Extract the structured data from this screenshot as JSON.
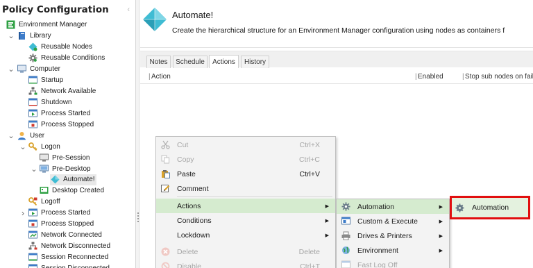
{
  "nav": {
    "title": "Policy Configuration",
    "collapse_glyph": "‹",
    "tree": [
      {
        "label": "Environment Manager",
        "icon": "environment-manager-icon",
        "twist": "",
        "selected": false
      },
      {
        "label": "Library",
        "icon": "library-book-icon",
        "twist": "v",
        "selected": false
      },
      {
        "label": "Reusable Nodes",
        "icon": "reusable-nodes-icon",
        "twist": "",
        "selected": false
      },
      {
        "label": "Reusable Conditions",
        "icon": "reusable-conditions-gear-icon",
        "twist": "",
        "selected": false
      },
      {
        "label": "Computer",
        "icon": "computer-monitor-icon",
        "twist": "v",
        "selected": false
      },
      {
        "label": "Startup",
        "icon": "startup-window-icon",
        "twist": "",
        "selected": false
      },
      {
        "label": "Network Available",
        "icon": "network-available-icon",
        "twist": "",
        "selected": false
      },
      {
        "label": "Shutdown",
        "icon": "shutdown-window-icon",
        "twist": "",
        "selected": false
      },
      {
        "label": "Process Started",
        "icon": "process-started-window-icon",
        "twist": "",
        "selected": false
      },
      {
        "label": "Process Stopped",
        "icon": "process-stopped-window-icon",
        "twist": "",
        "selected": false
      },
      {
        "label": "User",
        "icon": "user-icon",
        "twist": "v",
        "selected": false
      },
      {
        "label": "Logon",
        "icon": "logon-key-icon",
        "twist": "v",
        "selected": false
      },
      {
        "label": "Pre-Session",
        "icon": "pre-session-monitor-icon",
        "twist": "",
        "selected": false
      },
      {
        "label": "Pre-Desktop",
        "icon": "pre-desktop-monitor-icon",
        "twist": "v",
        "selected": false
      },
      {
        "label": "Automate!",
        "icon": "automate-diamond-icon",
        "twist": "",
        "selected": true
      },
      {
        "label": "Desktop Created",
        "icon": "desktop-created-icon",
        "twist": "",
        "selected": false
      },
      {
        "label": "Logoff",
        "icon": "logoff-key-icon",
        "twist": "",
        "selected": false
      },
      {
        "label": "Process Started",
        "icon": "process-started-window-icon",
        "twist": ">",
        "selected": false
      },
      {
        "label": "Process Stopped",
        "icon": "process-stopped-window-icon",
        "twist": "",
        "selected": false
      },
      {
        "label": "Network Connected",
        "icon": "network-connected-icon",
        "twist": "",
        "selected": false
      },
      {
        "label": "Network Disconnected",
        "icon": "network-disconnected-icon",
        "twist": "",
        "selected": false
      },
      {
        "label": "Session Reconnected",
        "icon": "session-reconnected-icon",
        "twist": "",
        "selected": false
      },
      {
        "label": "Session Disconnected",
        "icon": "session-disconnected-icon",
        "twist": "",
        "selected": false
      }
    ]
  },
  "header": {
    "title": "Automate!",
    "description": "Create the hierarchical structure for an Environment Manager configuration using nodes as containers f",
    "icon": "automate-diamond-icon"
  },
  "tabs": [
    {
      "label": "Notes",
      "active": false
    },
    {
      "label": "Schedule",
      "active": false
    },
    {
      "label": "Actions",
      "active": true
    },
    {
      "label": "History",
      "active": false
    }
  ],
  "columns": {
    "action": "Action",
    "enabled": "Enabled",
    "stop_sub_nodes": "Stop sub nodes on fail"
  },
  "context_menu": {
    "items": [
      {
        "label": "Cut",
        "shortcut": "Ctrl+X",
        "icon": "scissors-icon",
        "disabled": true,
        "submenu": false,
        "highlighted": false
      },
      {
        "label": "Copy",
        "shortcut": "Ctrl+C",
        "icon": "copy-icon",
        "disabled": true,
        "submenu": false,
        "highlighted": false
      },
      {
        "label": "Paste",
        "shortcut": "Ctrl+V",
        "icon": "paste-clipboard-icon",
        "disabled": false,
        "submenu": false,
        "highlighted": false
      },
      {
        "label": "Comment",
        "shortcut": "",
        "icon": "comment-pencil-icon",
        "disabled": false,
        "submenu": false,
        "highlighted": false
      },
      {
        "label": "Actions",
        "shortcut": "",
        "icon": "",
        "disabled": false,
        "submenu": true,
        "highlighted": true
      },
      {
        "label": "Conditions",
        "shortcut": "",
        "icon": "",
        "disabled": false,
        "submenu": true,
        "highlighted": false
      },
      {
        "label": "Lockdown",
        "shortcut": "",
        "icon": "",
        "disabled": false,
        "submenu": true,
        "highlighted": false
      },
      {
        "label": "Delete",
        "shortcut": "Delete",
        "icon": "delete-icon",
        "disabled": true,
        "submenu": false,
        "highlighted": false
      },
      {
        "label": "Disable",
        "shortcut": "Ctrl+T",
        "icon": "disable-icon",
        "disabled": true,
        "submenu": false,
        "highlighted": false
      }
    ]
  },
  "actions_submenu": {
    "items": [
      {
        "label": "Automation",
        "icon": "automation-gear-icon",
        "disabled": false,
        "submenu": true,
        "highlighted": true
      },
      {
        "label": "Custom & Execute",
        "icon": "custom-execute-icon",
        "disabled": false,
        "submenu": true,
        "highlighted": false
      },
      {
        "label": "Drives & Printers",
        "icon": "drives-printers-icon",
        "disabled": false,
        "submenu": true,
        "highlighted": false
      },
      {
        "label": "Environment",
        "icon": "environment-icon",
        "disabled": false,
        "submenu": true,
        "highlighted": false
      },
      {
        "label": "Fast Log Off",
        "icon": "fast-log-off-icon",
        "disabled": true,
        "submenu": false,
        "highlighted": false
      }
    ]
  },
  "automation_submenu": {
    "items": [
      {
        "label": "Automation",
        "icon": "automation-gear-icon",
        "highlighted": true
      }
    ]
  },
  "colors": {
    "highlight": "#d5ebcf",
    "callout_border": "#e10f0f",
    "automate_diamond": "#3fbcd3"
  }
}
